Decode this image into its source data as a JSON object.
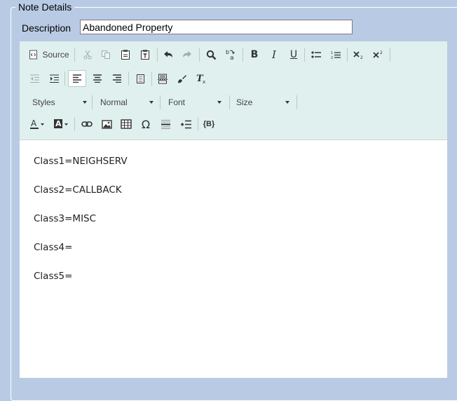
{
  "section": {
    "legend": "Note Details"
  },
  "description": {
    "label": "Description",
    "value": "Abandoned Property"
  },
  "toolbar": {
    "source_label": "Source",
    "combos": {
      "styles": "Styles",
      "format": "Normal",
      "font": "Font",
      "size": "Size"
    },
    "placeholder_label": "{B}"
  },
  "content": {
    "lines": [
      "Class1=NEIGHSERV",
      "Class2=CALLBACK",
      "Class3=MISC",
      "Class4=",
      "Class5="
    ]
  }
}
